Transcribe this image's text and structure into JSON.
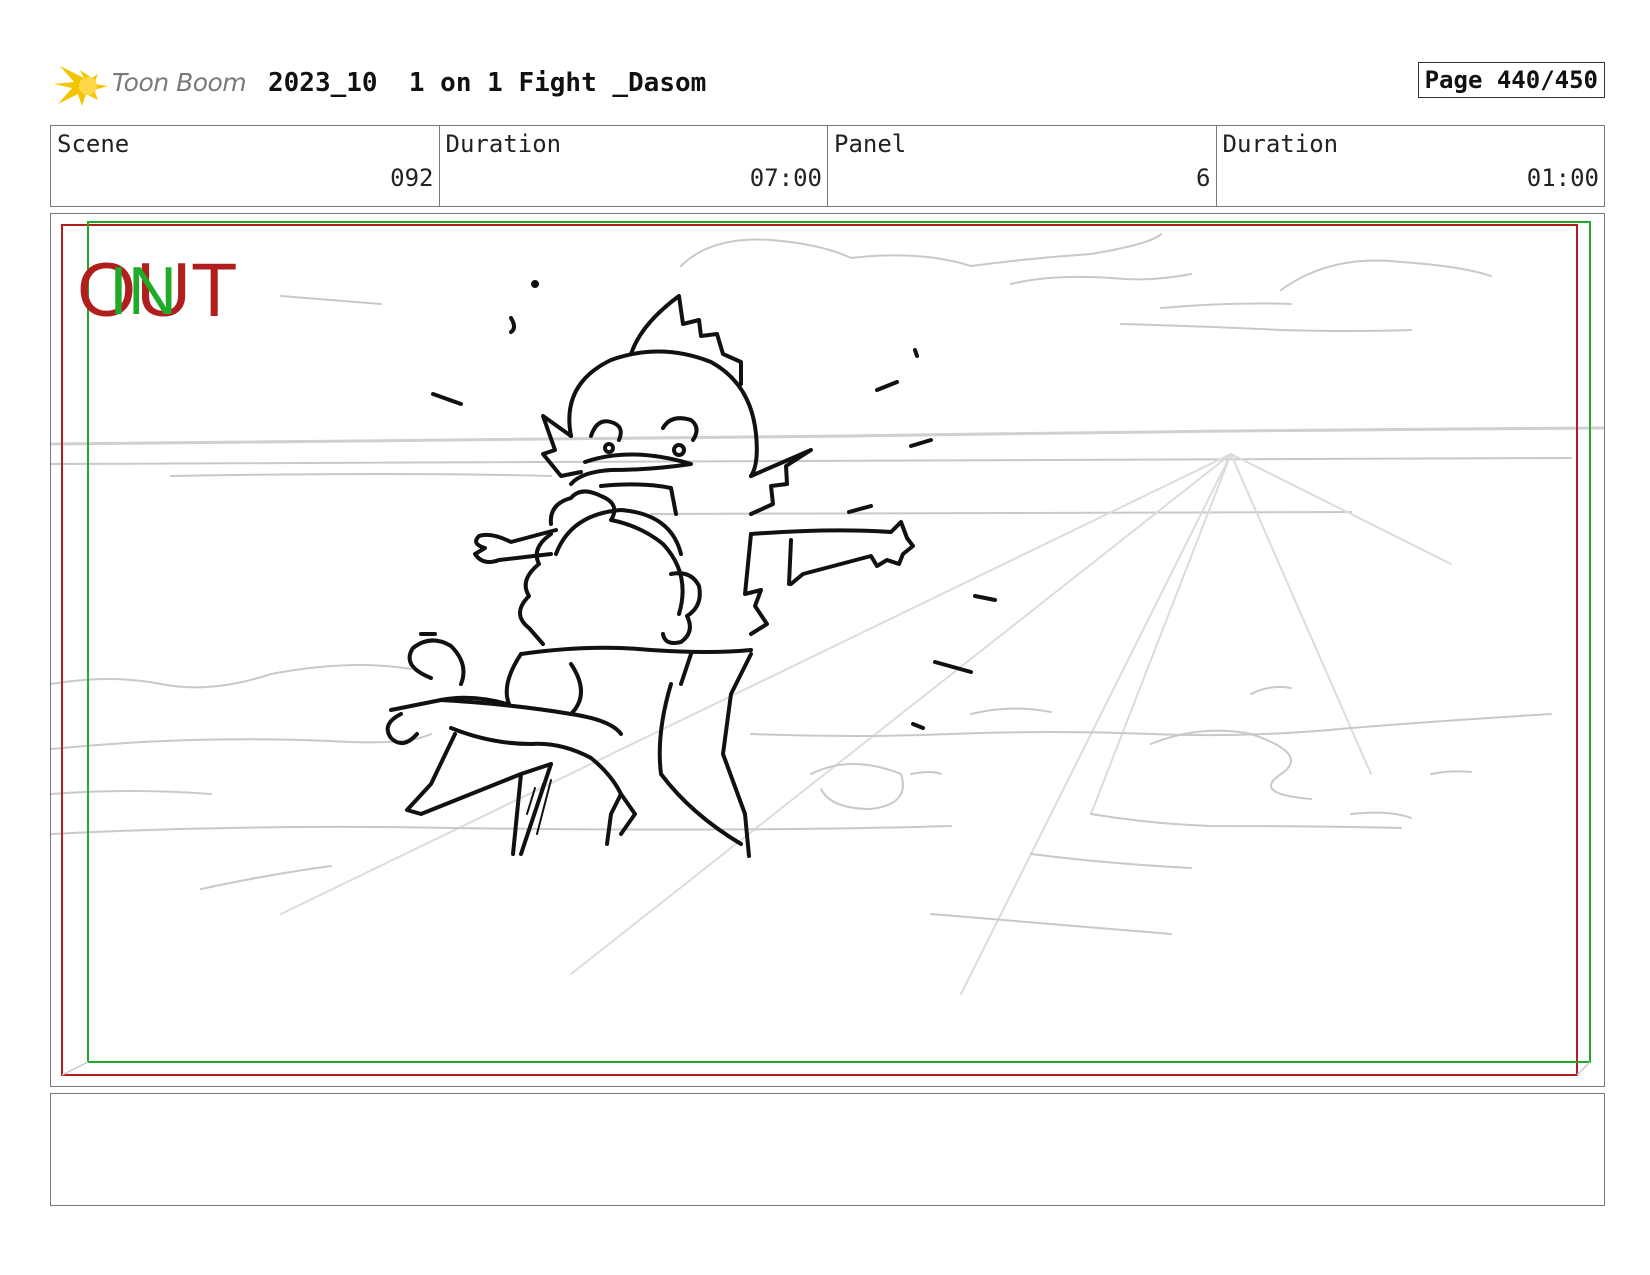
{
  "header": {
    "logo_text": "Toon Boom",
    "title": "2023_10  1 on 1 Fight _Dasom",
    "page_label": "Page 440/450"
  },
  "info": {
    "scene_label": "Scene",
    "scene_value": "092",
    "scene_duration_label": "Duration",
    "scene_duration_value": "07:00",
    "panel_label": "Panel",
    "panel_value": "6",
    "panel_duration_label": "Duration",
    "panel_duration_value": "01:00"
  },
  "frame": {
    "out_label": "OUT",
    "in_label": "IN",
    "out_color": "#b01e1e",
    "in_color": "#1faa2a"
  },
  "notes": {
    "text": ""
  },
  "icons": {
    "logo": "toon-boom-sun-icon"
  }
}
